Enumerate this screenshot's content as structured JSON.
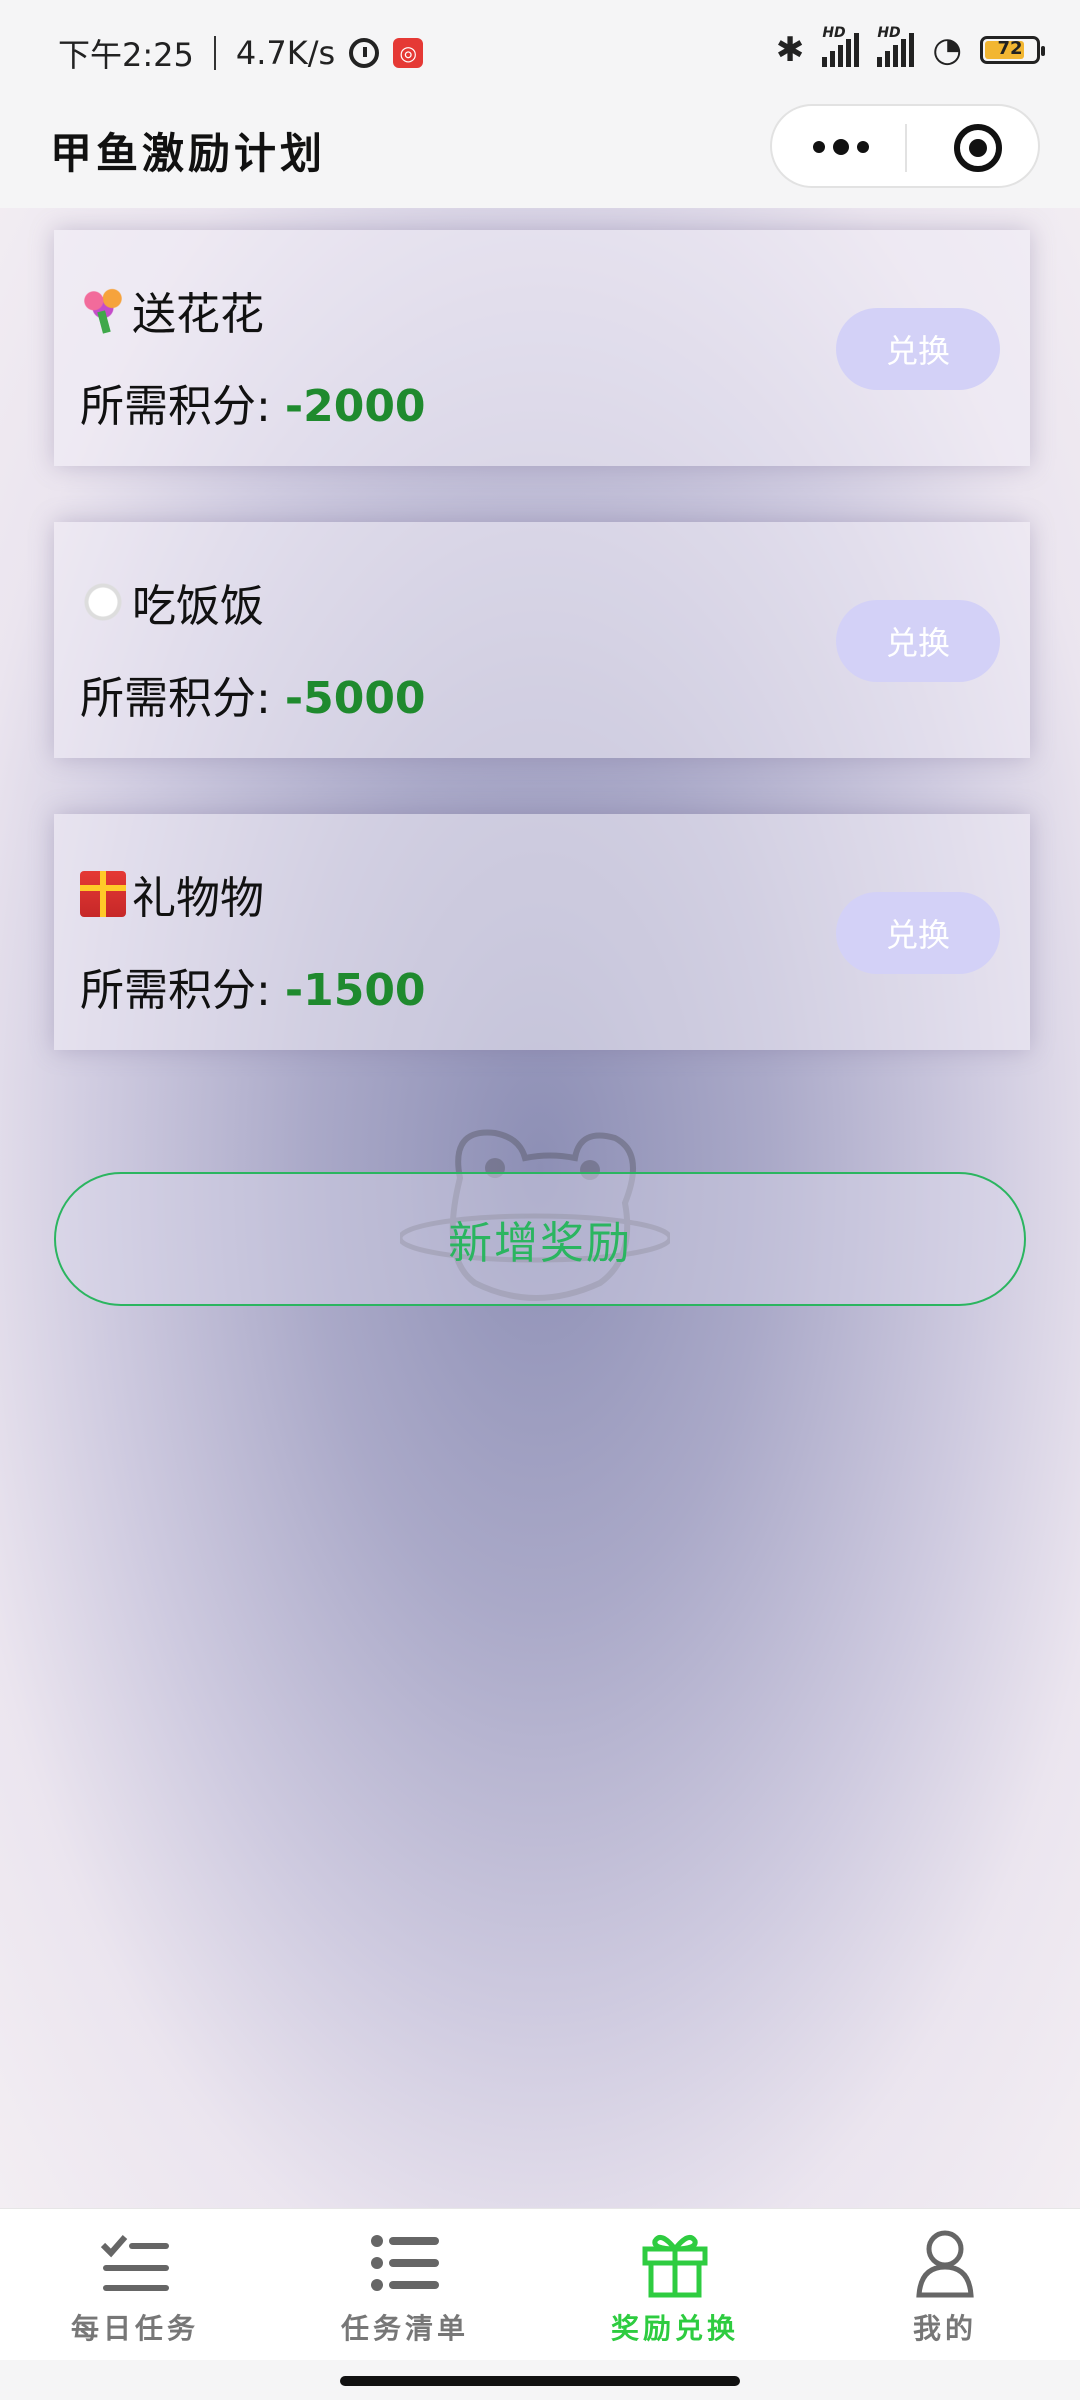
{
  "status_bar": {
    "time": "下午2:25",
    "net_speed": "4.7K/s",
    "hd_label_1": "HD",
    "hd_label_2": "HD",
    "battery_level": "72"
  },
  "header": {
    "title": "甲鱼激励计划"
  },
  "rewards": [
    {
      "icon": "bouquet-emoji-icon",
      "name": "送花花",
      "cost_label": "所需积分:",
      "cost_value": "-2000",
      "button_label": "兑换"
    },
    {
      "icon": "plate-emoji-icon",
      "name": "吃饭饭",
      "cost_label": "所需积分:",
      "cost_value": "-5000",
      "button_label": "兑换"
    },
    {
      "icon": "gift-emoji-icon",
      "name": "礼物物",
      "cost_label": "所需积分:",
      "cost_value": "-1500",
      "button_label": "兑换"
    }
  ],
  "add_reward_label": "新增奖励",
  "tabs": [
    {
      "label": "每日任务",
      "icon": "checklist-icon",
      "active": false
    },
    {
      "label": "任务清单",
      "icon": "list-icon",
      "active": false
    },
    {
      "label": "奖励兑换",
      "icon": "gift-icon",
      "active": true
    },
    {
      "label": "我的",
      "icon": "user-icon",
      "active": false
    }
  ],
  "colors": {
    "accent_green": "#2ecc40",
    "cost_green": "#1f8a2e",
    "redeem_button": "#d3d1f7"
  }
}
